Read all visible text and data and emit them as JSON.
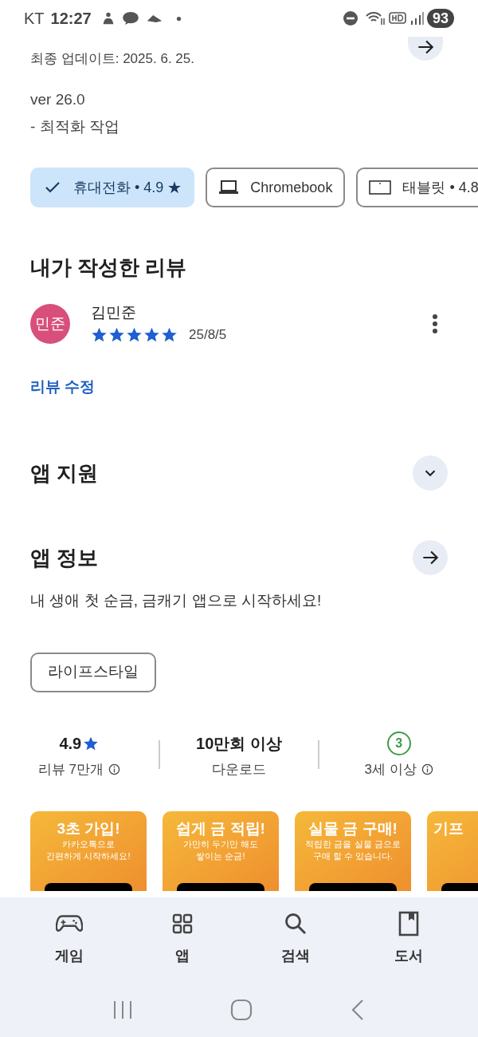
{
  "status_bar": {
    "carrier": "KT",
    "time": "12:27",
    "battery": "93"
  },
  "whats_new": {
    "updated": "최종 업데이트: 2025. 6. 25.",
    "lines": [
      "ver 26.0",
      "- 최적화 작업"
    ]
  },
  "device_chips": [
    {
      "label": "휴대전화 • 4.9 ★",
      "kind": "phone",
      "selected": true
    },
    {
      "label": "Chromebook",
      "kind": "laptop",
      "selected": false
    },
    {
      "label": "태블릿 • 4.8",
      "kind": "tablet",
      "selected": false
    }
  ],
  "my_review": {
    "title": "내가 작성한 리뷰",
    "avatar": "민준",
    "name": "김민준",
    "stars": 5,
    "date": "25/8/5",
    "edit_link": "리뷰 수정"
  },
  "app_support": {
    "title": "앱 지원",
    "expanded": false
  },
  "app_info": {
    "title": "앱 정보",
    "description": "내 생애 첫 순금, 금캐기 앱으로 시작하세요!",
    "category": "라이프스타일"
  },
  "stats": [
    {
      "value": "4.9",
      "star": true,
      "label": "리뷰 7만개",
      "info": true
    },
    {
      "value": "10만회 이상",
      "label": "다운로드"
    },
    {
      "value": "3",
      "kind": "badge",
      "label": "3세 이상",
      "info": true
    }
  ],
  "screenshots": [
    {
      "title": "3초 가입!",
      "lines": [
        "카카오톡으로",
        "간편하게 시작하세요!"
      ]
    },
    {
      "title": "쉽게 금 적립!",
      "lines": [
        "가만히 두기만 해도",
        "쌓이는 순금!"
      ]
    },
    {
      "title": "실물 금 구매!",
      "lines": [
        "적립한 금을 실물 금으로",
        "구매 할 수 있습니다."
      ]
    },
    {
      "title": "기프",
      "kind": "edge"
    }
  ],
  "bottom_nav": [
    {
      "label": "게임",
      "kind": "game"
    },
    {
      "label": "앱",
      "kind": "apps"
    },
    {
      "label": "검색",
      "kind": "search"
    },
    {
      "label": "도서",
      "kind": "book"
    }
  ]
}
